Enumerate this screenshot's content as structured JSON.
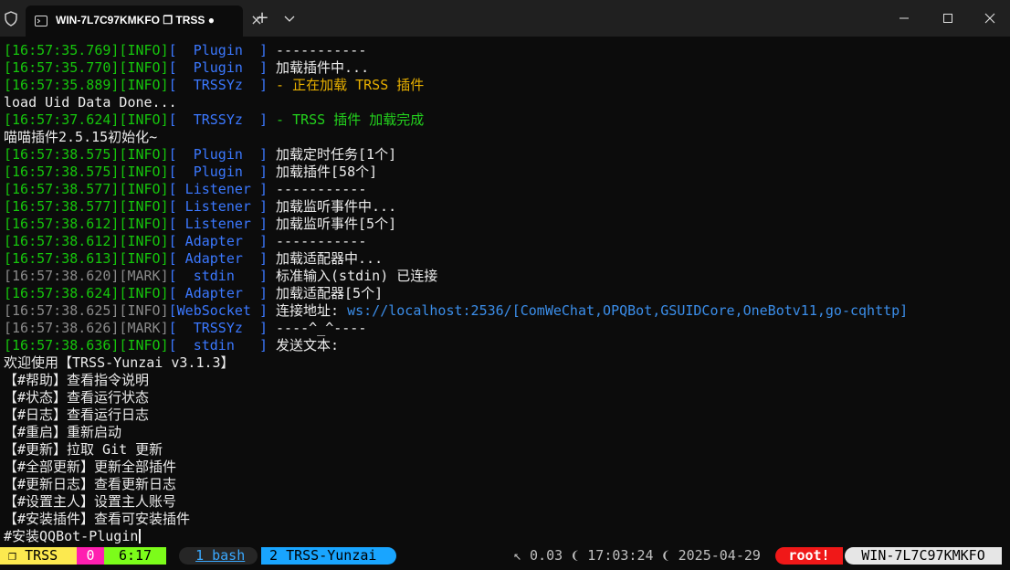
{
  "titlebar": {
    "tab_title": "WIN-7L7C97KMKFO ❐ TRSS ●",
    "close_tab": "×",
    "new_tab": "+"
  },
  "terminal": {
    "lines": [
      {
        "ts": "[16:57:35.769][INFO]",
        "mod": "[  Plugin  ]",
        "msg": " -----------"
      },
      {
        "ts": "[16:57:35.770][INFO]",
        "mod": "[  Plugin  ]",
        "msg": " 加载插件中..."
      },
      {
        "ts": "[16:57:35.889][INFO]",
        "mod": "[  TRSSYz  ]",
        "msg": " - 正在加载 TRSS 插件"
      },
      {
        "plain": "load Uid Data Done..."
      },
      {
        "ts": "[16:57:37.624][INFO]",
        "mod": "[  TRSSYz  ]",
        "msg": " - TRSS 插件 加载完成"
      },
      {
        "plain": "喵喵插件2.5.15初始化~"
      },
      {
        "ts": "[16:57:38.575][INFO]",
        "mod": "[  Plugin  ]",
        "msg": " 加载定时任务[1个]"
      },
      {
        "ts": "[16:57:38.575][INFO]",
        "mod": "[  Plugin  ]",
        "msg": " 加载插件[58个]"
      },
      {
        "ts": "[16:57:38.577][INFO]",
        "mod": "[ Listener ]",
        "msg": " -----------"
      },
      {
        "ts": "[16:57:38.577][INFO]",
        "mod": "[ Listener ]",
        "msg": " 加载监听事件中..."
      },
      {
        "ts": "[16:57:38.612][INFO]",
        "mod": "[ Listener ]",
        "msg": " 加载监听事件[5个]"
      },
      {
        "ts": "[16:57:38.612][INFO]",
        "mod": "[ Adapter  ]",
        "msg": " -----------"
      },
      {
        "ts": "[16:57:38.613][INFO]",
        "mod": "[ Adapter  ]",
        "msg": " 加载适配器中..."
      },
      {
        "ts": "[16:57:38.620][MARK]",
        "mod": "[  stdin   ]",
        "msg": " 标准输入(stdin) 已连接"
      },
      {
        "ts": "[16:57:38.624][INFO]",
        "mod": "[ Adapter  ]",
        "msg": " 加载适配器[5个]"
      },
      {
        "ts": "[16:57:38.625][INFO]",
        "mod": "[WebSocket ]",
        "msg": " 连接地址: ",
        "url": "ws://localhost:2536/",
        "list": "[ComWeChat,OPQBot,GSUIDCore,OneBotv11,go-cqhttp]"
      },
      {
        "ts": "[16:57:38.626][MARK]",
        "mod": "[  TRSSYz  ]",
        "msg": " ----^_^----"
      },
      {
        "ts": "[16:57:38.636][INFO]",
        "mod": "[  stdin   ]",
        "msg": " 发送文本:"
      },
      {
        "plain": "欢迎使用【TRSS-Yunzai v3.1.3】"
      },
      {
        "plain": "【#帮助】查看指令说明"
      },
      {
        "plain": "【#状态】查看运行状态"
      },
      {
        "plain": "【#日志】查看运行日志"
      },
      {
        "plain": "【#重启】重新启动"
      },
      {
        "plain": "【#更新】拉取 Git 更新"
      },
      {
        "plain": "【#全部更新】更新全部插件"
      },
      {
        "plain": "【#更新日志】查看更新日志"
      },
      {
        "plain": "【#设置主人】设置主人账号"
      },
      {
        "plain": "【#安装插件】查看可安装插件"
      }
    ],
    "input": "#安装QQBot-Plugin"
  },
  "statusbar": {
    "session": " ❐ TRSS ",
    "session_num": "0",
    "session_time": "6:17",
    "window1": "1 bash",
    "window2": " 2 TRSS-Yunzai",
    "load": "↖ 0.03 ❨ 17:03:24 ❨ 2025-04-29",
    "user": "root!",
    "host": "WIN-7L7C97KMKFO"
  },
  "colors": {
    "background": "#0c0c0c",
    "timestamp": "#16c60c",
    "module": "#3b78ff",
    "mark": "#8a8a8a",
    "trss_loading": "#e8b000"
  }
}
